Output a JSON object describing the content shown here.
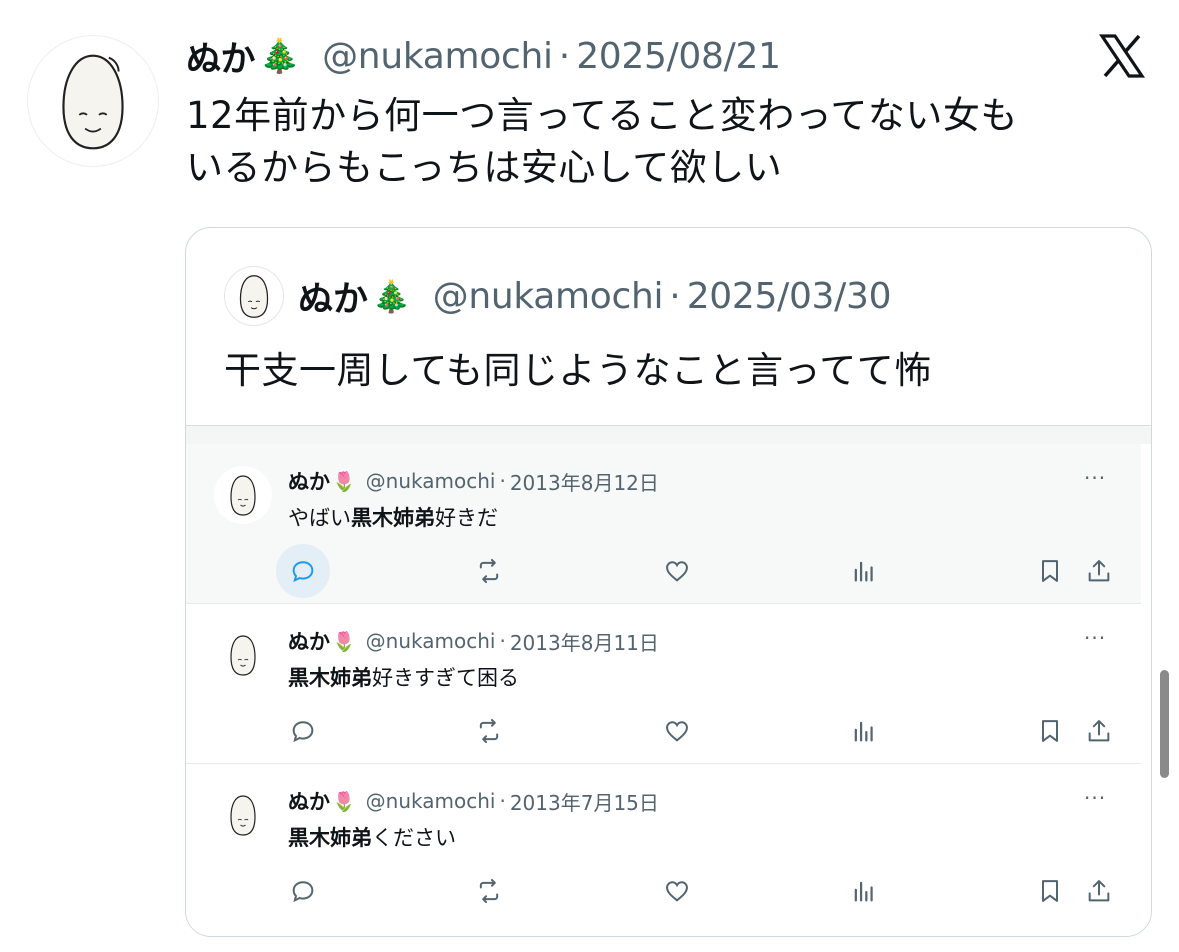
{
  "main_tweet": {
    "name": "ぬか",
    "name_emoji": "🎄",
    "handle": "@nukamochi",
    "separator": "·",
    "date": "2025/08/21",
    "text_line1": "12年前から何一つ言ってること変わってない女も",
    "text_line2": "いるからもこっちは安心して欲しい",
    "platform_icon": "x-logo-icon",
    "avatar_icon": "rice-grain-avatar-icon"
  },
  "quoted_tweet": {
    "name": "ぬか",
    "name_emoji": "🎄",
    "handle": "@nukamochi",
    "separator": "·",
    "date": "2025/03/30",
    "text": "干支一周しても同じようなこと言ってて怖"
  },
  "embedded_screenshot": {
    "tweets": [
      {
        "name": "ぬか",
        "emoji": "🌷",
        "handle": "@nukamochi",
        "separator": "·",
        "date": "2013年8月12日",
        "text_before": "やばい",
        "text_bold": "黒木姉弟",
        "text_after": "好きだ",
        "more": "···"
      },
      {
        "name": "ぬか",
        "emoji": "🌷",
        "handle": "@nukamochi",
        "separator": "·",
        "date": "2013年8月11日",
        "text_before": "",
        "text_bold": "黒木姉弟",
        "text_after": "好きすぎて困る",
        "more": "···"
      },
      {
        "name": "ぬか",
        "emoji": "🌷",
        "handle": "@nukamochi",
        "separator": "·",
        "date": "2013年7月15日",
        "text_before": "",
        "text_bold": "黒木姉弟",
        "text_after": "ください",
        "more": "···"
      }
    ],
    "action_icons": [
      "reply-icon",
      "retweet-icon",
      "like-icon",
      "views-icon",
      "bookmark-icon",
      "share-icon"
    ]
  },
  "colors": {
    "text": "#0f1419",
    "secondary": "#536471",
    "border": "#cfd9de",
    "reply_hover_bg": "#e3eef6"
  }
}
